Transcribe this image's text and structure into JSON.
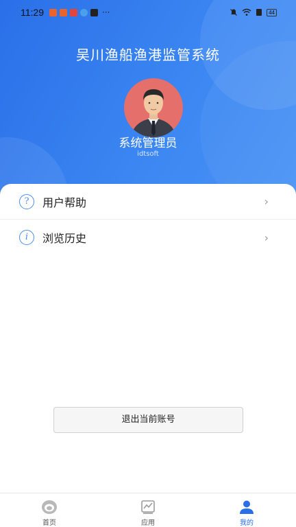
{
  "status_bar": {
    "time": "11:29",
    "more": "···",
    "battery": "44"
  },
  "header": {
    "title": "吴川渔船渔港监管系统",
    "user_name": "系统管理员",
    "user_account": "idtsoft"
  },
  "menu": [
    {
      "label": "用户帮助",
      "icon": "help-circle-icon"
    },
    {
      "label": "浏览历史",
      "icon": "info-circle-icon"
    }
  ],
  "logout_label": "退出当前账号",
  "tabs": [
    {
      "label": "首页",
      "icon": "home-icon",
      "active": false
    },
    {
      "label": "应用",
      "icon": "chart-icon",
      "active": false
    },
    {
      "label": "我的",
      "icon": "user-icon",
      "active": true
    }
  ],
  "colors": {
    "header_start": "#2a6fe8",
    "header_end": "#4a94f5",
    "accent": "#4a8ee8",
    "avatar_bg": "#e56f6a",
    "active_tab": "#2a6fe8"
  }
}
